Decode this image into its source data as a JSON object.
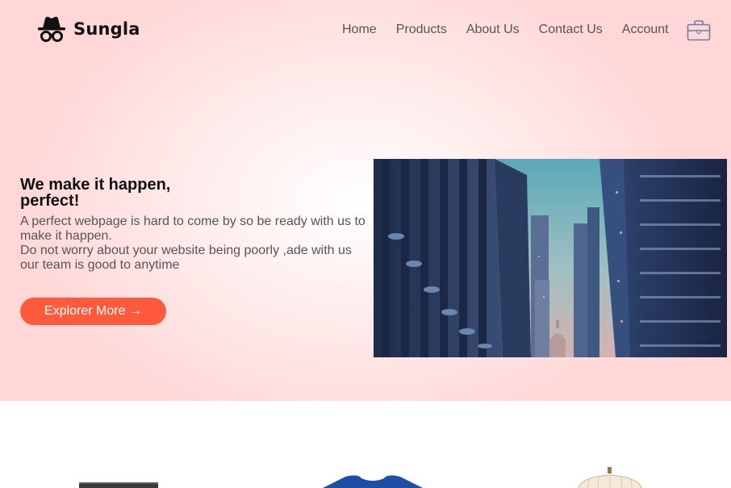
{
  "brand": {
    "name": "Sungla",
    "logo_icon": "spy-hat-glasses-icon"
  },
  "nav": {
    "items": [
      {
        "label": "Home"
      },
      {
        "label": "Products"
      },
      {
        "label": "About Us"
      },
      {
        "label": "Contact Us"
      },
      {
        "label": "Account"
      }
    ],
    "cart_icon": "briefcase-cart-icon"
  },
  "hero": {
    "headline_line1": "We make it happen,",
    "headline_line2": "perfect!",
    "desc_line1": "A perfect webpage is hard to come by so be ready with us to make it happen.",
    "desc_line2": "Do not worry about your website being poorly ,ade with us our team is good to anytime",
    "cta_label": "Explorer More →",
    "image_subject": "city skyscrapers street view"
  },
  "colors": {
    "accent": "#ff5a3c",
    "hero_bg": "#ffd7d7",
    "text_dark": "#111111",
    "text_muted": "#555555"
  },
  "products": {
    "items": [
      {
        "icon": "black-cylinder-product"
      },
      {
        "icon": "blue-tshirt-product"
      },
      {
        "icon": "lamp-product"
      }
    ]
  }
}
